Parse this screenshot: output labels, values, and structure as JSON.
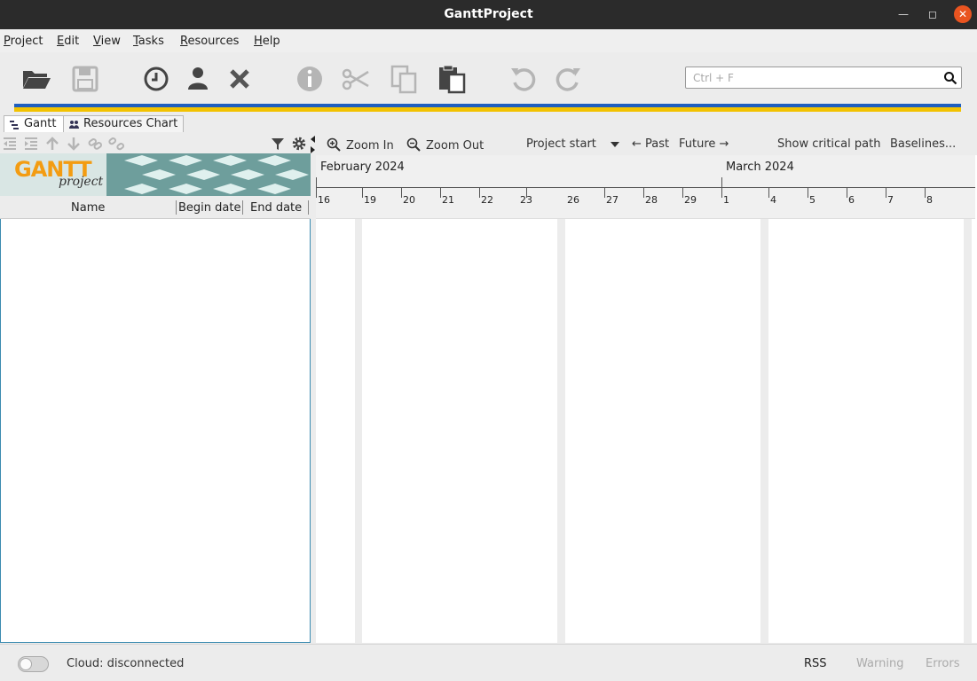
{
  "window": {
    "title": "GanttProject"
  },
  "menu": {
    "items": [
      "Project",
      "Edit",
      "View",
      "Tasks",
      "Resources",
      "Help"
    ]
  },
  "search": {
    "placeholder": "Ctrl + F",
    "value": ""
  },
  "tabs": [
    {
      "label": "Gantt"
    },
    {
      "label": "Resources Chart"
    }
  ],
  "task_table": {
    "columns": [
      "Name",
      "Begin date",
      "End date"
    ],
    "rows": []
  },
  "banner": {
    "logo_text": "GANTT",
    "logo_sub": "project"
  },
  "chart_toolbar": {
    "zoom_in": "Zoom In",
    "zoom_out": "Zoom Out",
    "project_start": "Project start",
    "past": "← Past",
    "future": "Future →",
    "critical_path": "Show critical path",
    "baselines": "Baselines..."
  },
  "timeline": {
    "months": [
      "February 2024",
      "March 2024"
    ],
    "days": [
      "16",
      "19",
      "20",
      "21",
      "22",
      "23",
      "26",
      "27",
      "28",
      "29",
      "1",
      "4",
      "5",
      "6",
      "7",
      "8"
    ]
  },
  "status": {
    "cloud": "Cloud: disconnected",
    "rss": "RSS",
    "warning": "Warning",
    "errors": "Errors"
  },
  "colors": {
    "titlebar": "#2b2b2b",
    "close": "#e95420",
    "flag_blue": "#1f5fbf",
    "flag_yellow": "#f2c200",
    "focus_border": "#3a8bb0"
  }
}
